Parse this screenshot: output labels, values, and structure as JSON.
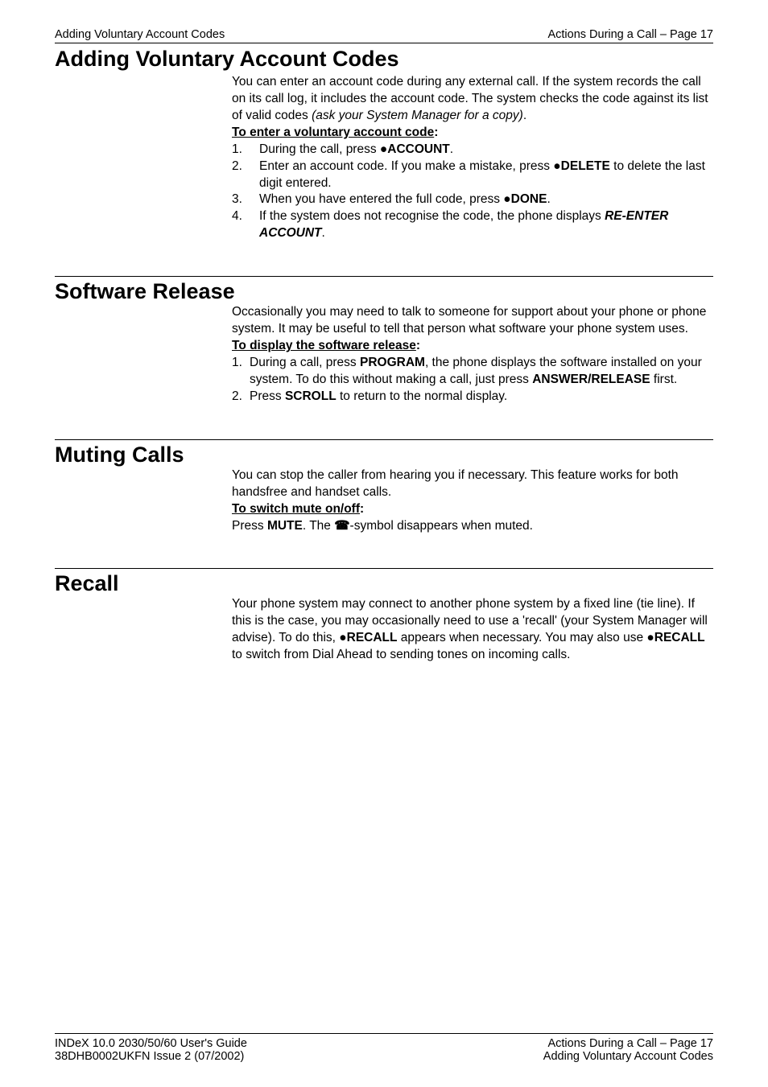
{
  "header": {
    "left": "Adding Voluntary Account Codes",
    "right": "Actions During a Call – Page 17"
  },
  "sections": {
    "accountCodes": {
      "title": "Adding Voluntary Account Codes",
      "intro_a": "You can enter an account code during any external call. If the system records the call on its call log, it includes the account code. The system checks the code against its list of valid codes ",
      "intro_b_italic": "(ask your System Manager for a copy)",
      "intro_c": ".",
      "subhead": "To enter a voluntary account code",
      "colon": ":",
      "steps": {
        "s1_a": "During the call, press ●",
        "s1_b_bold": "ACCOUNT",
        "s1_c": ".",
        "s2_a": "Enter an account code. If you make a mistake, press ●",
        "s2_b_bold": "DELETE",
        "s2_c": " to delete the last digit entered.",
        "s3_a": "When you have entered the full code, press ●",
        "s3_b_bold": "DONE",
        "s3_c": ".",
        "s4_a": "If the system does not recognise the code, the phone displays ",
        "s4_b_bi": "RE-ENTER ACCOUNT",
        "s4_c": "."
      },
      "nums": {
        "n1": "1.",
        "n2": "2.",
        "n3": "3.",
        "n4": "4."
      }
    },
    "softwareRelease": {
      "title": "Software Release",
      "intro": "Occasionally you may need to talk to someone for support about your phone or phone system. It may be useful to tell that person what software your phone system uses.",
      "subhead": "To display the software release",
      "colon": ":",
      "steps": {
        "s1_a": "During a call, press ",
        "s1_b_bold": "PROGRAM",
        "s1_c": ", the phone displays the software installed on your system. To do this without making a call, just press ",
        "s1_d_bold": "ANSWER/RELEASE",
        "s1_e": " first.",
        "s2_a": "Press ",
        "s2_b_bold": "SCROLL",
        "s2_c": " to return to the normal display."
      },
      "nums": {
        "n1": "1.",
        "n2": "2."
      }
    },
    "mutingCalls": {
      "title": "Muting Calls",
      "intro": "You can stop the caller from hearing you if necessary. This feature works for both handsfree and handset calls.",
      "subhead": "To switch mute on/off",
      "colon": ":",
      "line_a": "Press ",
      "line_b_bold": "MUTE",
      "line_c": ". The ",
      "line_d_sym": "☎",
      "line_e": "-symbol disappears when muted."
    },
    "recall": {
      "title": "Recall",
      "p_a": "Your phone system may connect to another phone system by a fixed line (tie line). If this is the case, you may occasionally need to use a 'recall' (your System Manager will advise). To do this, ●",
      "p_b_bold": "RECALL",
      "p_c": " appears when necessary. You may also use ●",
      "p_d_bold": "RECALL",
      "p_e": " to switch from Dial Ahead to sending tones on incoming calls."
    }
  },
  "footer": {
    "left1": "INDeX 10.0 2030/50/60 User's Guide",
    "left2": "38DHB0002UKFN Issue 2 (07/2002)",
    "right1": "Actions During a Call – Page 17",
    "right2": "Adding Voluntary Account Codes"
  }
}
